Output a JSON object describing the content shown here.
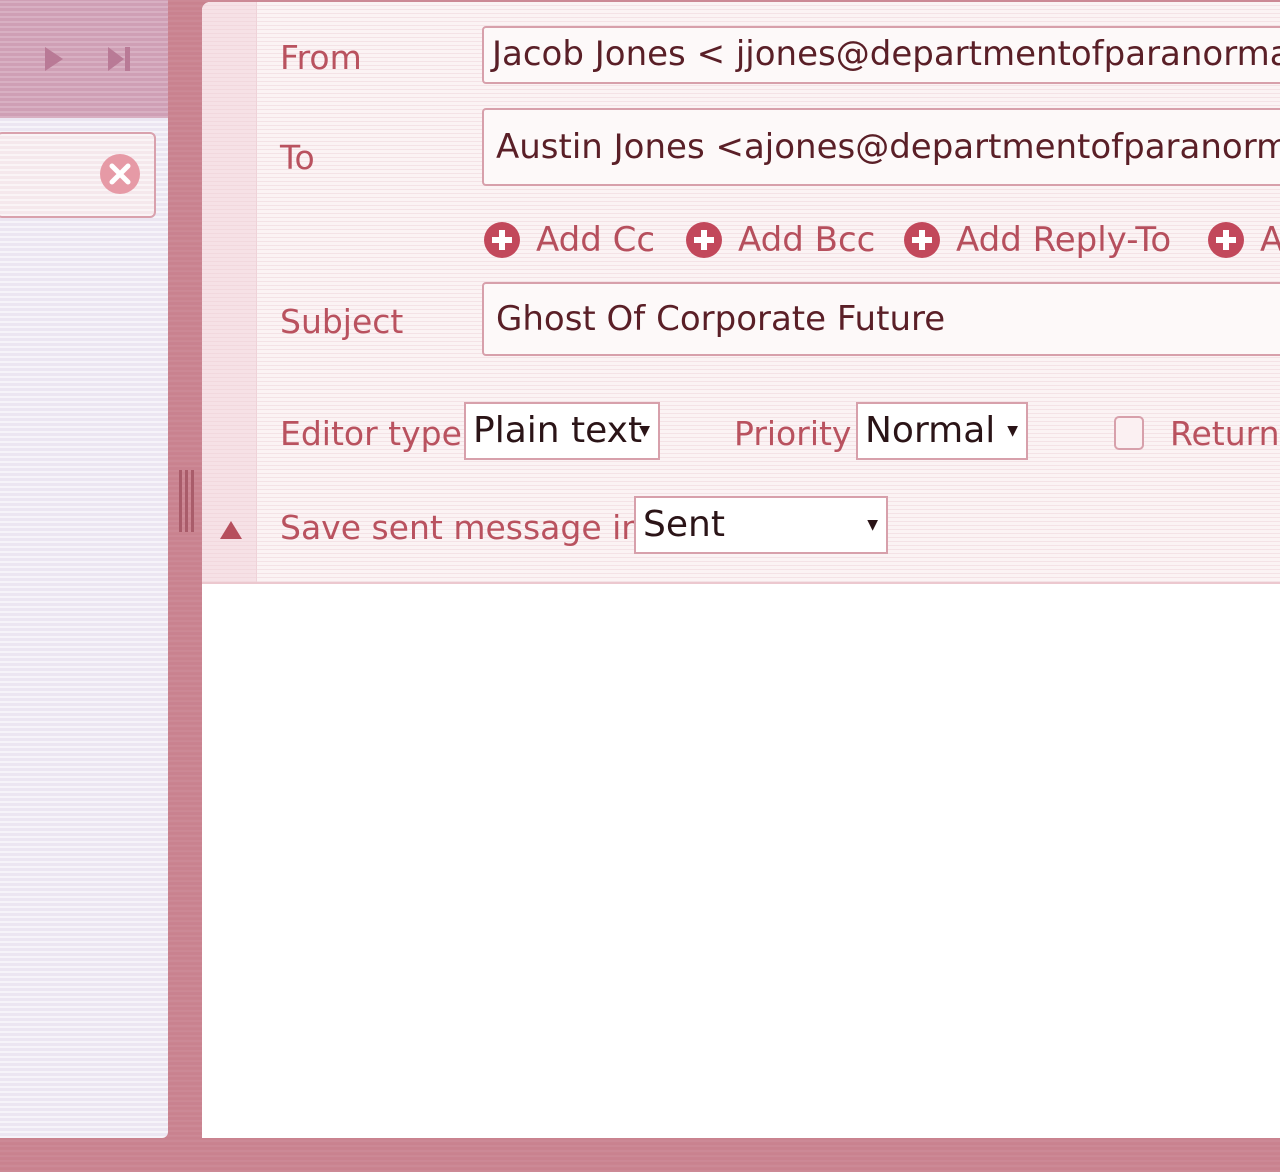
{
  "compose": {
    "from_label": "From",
    "from_value": "Jacob Jones < jjones@departmentofparanormalre",
    "to_label": "To",
    "to_value": "Austin Jones <ajones@departmentofparanormalre",
    "add_links": {
      "cc": "Add Cc",
      "bcc": "Add Bcc",
      "reply_to": "Add Reply-To",
      "more": "A"
    },
    "subject_label": "Subject",
    "subject_value": "Ghost Of Corporate Future",
    "editor_type_label": "Editor type",
    "editor_type_value": "Plain text",
    "priority_label": "Priority",
    "priority_value": "Normal",
    "return_label": "Return",
    "save_sent_label": "Save sent message in",
    "save_sent_value": "Sent"
  },
  "icons": {
    "nav_next": "play-icon",
    "nav_last": "skip-to-end-icon",
    "search_clear": "close-circle-icon",
    "add": "plus-circle-icon",
    "collapse": "triangle-up-icon"
  },
  "colors": {
    "accent": "#b9525f",
    "frame": "#c9828f",
    "sidebar": "#ece6f2"
  }
}
